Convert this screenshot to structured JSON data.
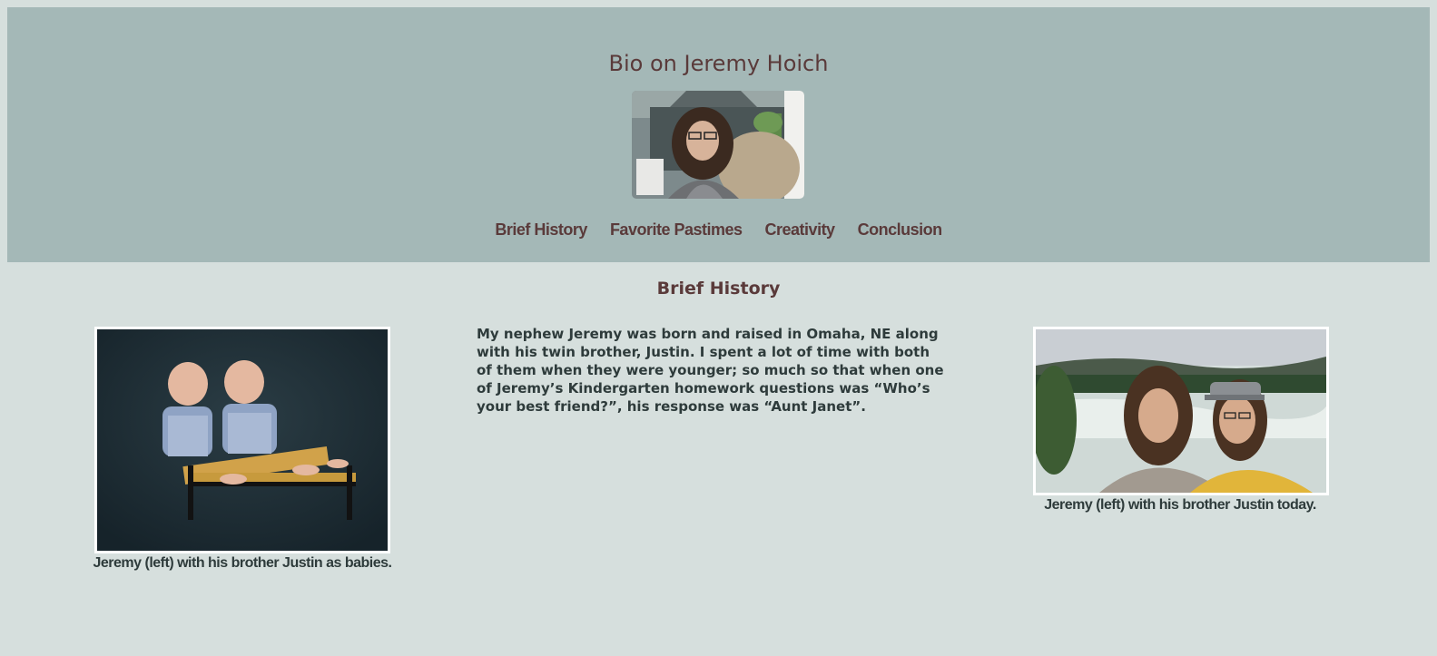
{
  "header": {
    "title": "Bio on Jeremy Hoich"
  },
  "nav": {
    "items": [
      {
        "label": "Brief History"
      },
      {
        "label": "Favorite Pastimes"
      },
      {
        "label": "Creativity"
      },
      {
        "label": "Conclusion"
      }
    ]
  },
  "section": {
    "title": "Brief History",
    "paragraph": "My nephew Jeremy was born and raised in Omaha, NE along with his twin brother, Justin. I spent a lot of time with both of them when they were younger; so much so that when one of Jeremy’s Kindergarten homework questions was “Who’s your best friend?”, his response was “Aunt Janet”."
  },
  "photos": {
    "left_caption": "Jeremy (left) with his brother Justin as babies.",
    "right_caption": "Jeremy (left) with his brother Justin today."
  },
  "colors": {
    "page_background": "#d6dfdd",
    "header_background": "#a4b8b7",
    "accent_text": "#5a3a3a",
    "body_text": "#2e3b3b"
  }
}
